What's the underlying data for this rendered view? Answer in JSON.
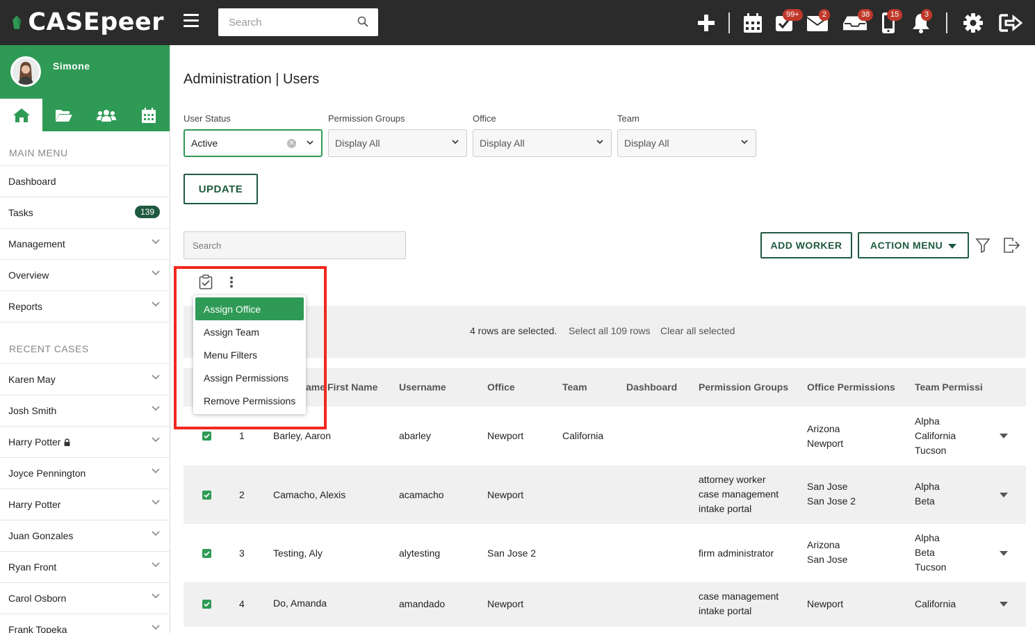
{
  "header": {
    "logo_text": "CASEpeer",
    "search_placeholder": "Search",
    "badges": {
      "tasks": "99+",
      "messages": "2",
      "inbox": "38",
      "mobile": "15",
      "notifications": "3"
    }
  },
  "sidebar": {
    "user_name": "Simone",
    "main_menu_title": "MAIN MENU",
    "main_items": [
      {
        "label": "Dashboard"
      },
      {
        "label": "Tasks",
        "count": "139"
      },
      {
        "label": "Management"
      },
      {
        "label": "Overview"
      },
      {
        "label": "Reports"
      }
    ],
    "recent_title": "RECENT CASES",
    "recent_items": [
      {
        "label": "Karen May"
      },
      {
        "label": "Josh Smith"
      },
      {
        "label": "Harry Potter"
      },
      {
        "label": "Joyce Pennington"
      },
      {
        "label": "Harry Potter"
      },
      {
        "label": "Juan Gonzales"
      },
      {
        "label": "Ryan Front"
      },
      {
        "label": "Carol Osborn"
      },
      {
        "label": "Frank Topeka"
      }
    ]
  },
  "page": {
    "title": "Administration | Users",
    "filters": [
      {
        "label": "User Status",
        "value": "Active"
      },
      {
        "label": "Permission Groups",
        "value": "Display All"
      },
      {
        "label": "Office",
        "value": "Display All"
      },
      {
        "label": "Team",
        "value": "Display All"
      }
    ],
    "update_label": "UPDATE",
    "table_search_placeholder": "Search",
    "add_worker_label": "ADD WORKER",
    "action_menu_label": "ACTION MENU"
  },
  "selection": {
    "text": "4 rows are selected.",
    "select_all": "Select all 109 rows",
    "clear_all": "Clear all selected"
  },
  "bulk_menu": {
    "items": [
      "Assign Office",
      "Assign Team",
      "Menu Filters",
      "Assign Permissions",
      "Remove Permissions"
    ]
  },
  "table": {
    "columns": [
      "ame",
      "First Name",
      "Username",
      "Office",
      "Team",
      "Dashboard",
      "Permission Groups",
      "Office Permissions",
      "Team Permissi"
    ],
    "rows": [
      {
        "num": "1",
        "name": "Barley, Aaron",
        "username": "abarley",
        "office": "Newport",
        "team": "California",
        "dashboard": "",
        "perm_groups": [],
        "office_perms": [
          "Arizona",
          "Newport"
        ],
        "team_perms": [
          "Alpha",
          "California",
          "Tucson"
        ]
      },
      {
        "num": "2",
        "name": "Camacho, Alexis",
        "username": "acamacho",
        "office": "Newport",
        "team": "",
        "dashboard": "",
        "perm_groups": [
          "attorney worker",
          "case management",
          "intake portal"
        ],
        "office_perms": [
          "San Jose",
          "San Jose 2"
        ],
        "team_perms": [
          "Alpha",
          "Beta"
        ]
      },
      {
        "num": "3",
        "name": "Testing, Aly",
        "username": "alytesting",
        "office": "San Jose 2",
        "team": "",
        "dashboard": "",
        "perm_groups": [
          "firm administrator"
        ],
        "office_perms": [
          "Arizona",
          "San Jose"
        ],
        "team_perms": [
          "Alpha",
          "Beta",
          "Tucson"
        ]
      },
      {
        "num": "4",
        "name": "Do, Amanda",
        "username": "amandado",
        "office": "Newport",
        "team": "",
        "dashboard": "",
        "perm_groups": [
          "case management",
          "intake portal"
        ],
        "office_perms": [
          "Newport"
        ],
        "team_perms": [
          "California"
        ]
      }
    ]
  },
  "colors": {
    "brand_green": "#2f9a55",
    "dark_green": "#1e5a40",
    "topbar": "#2b2b2b",
    "badge_red": "#c0392b",
    "highlight_red": "#f0281e"
  }
}
